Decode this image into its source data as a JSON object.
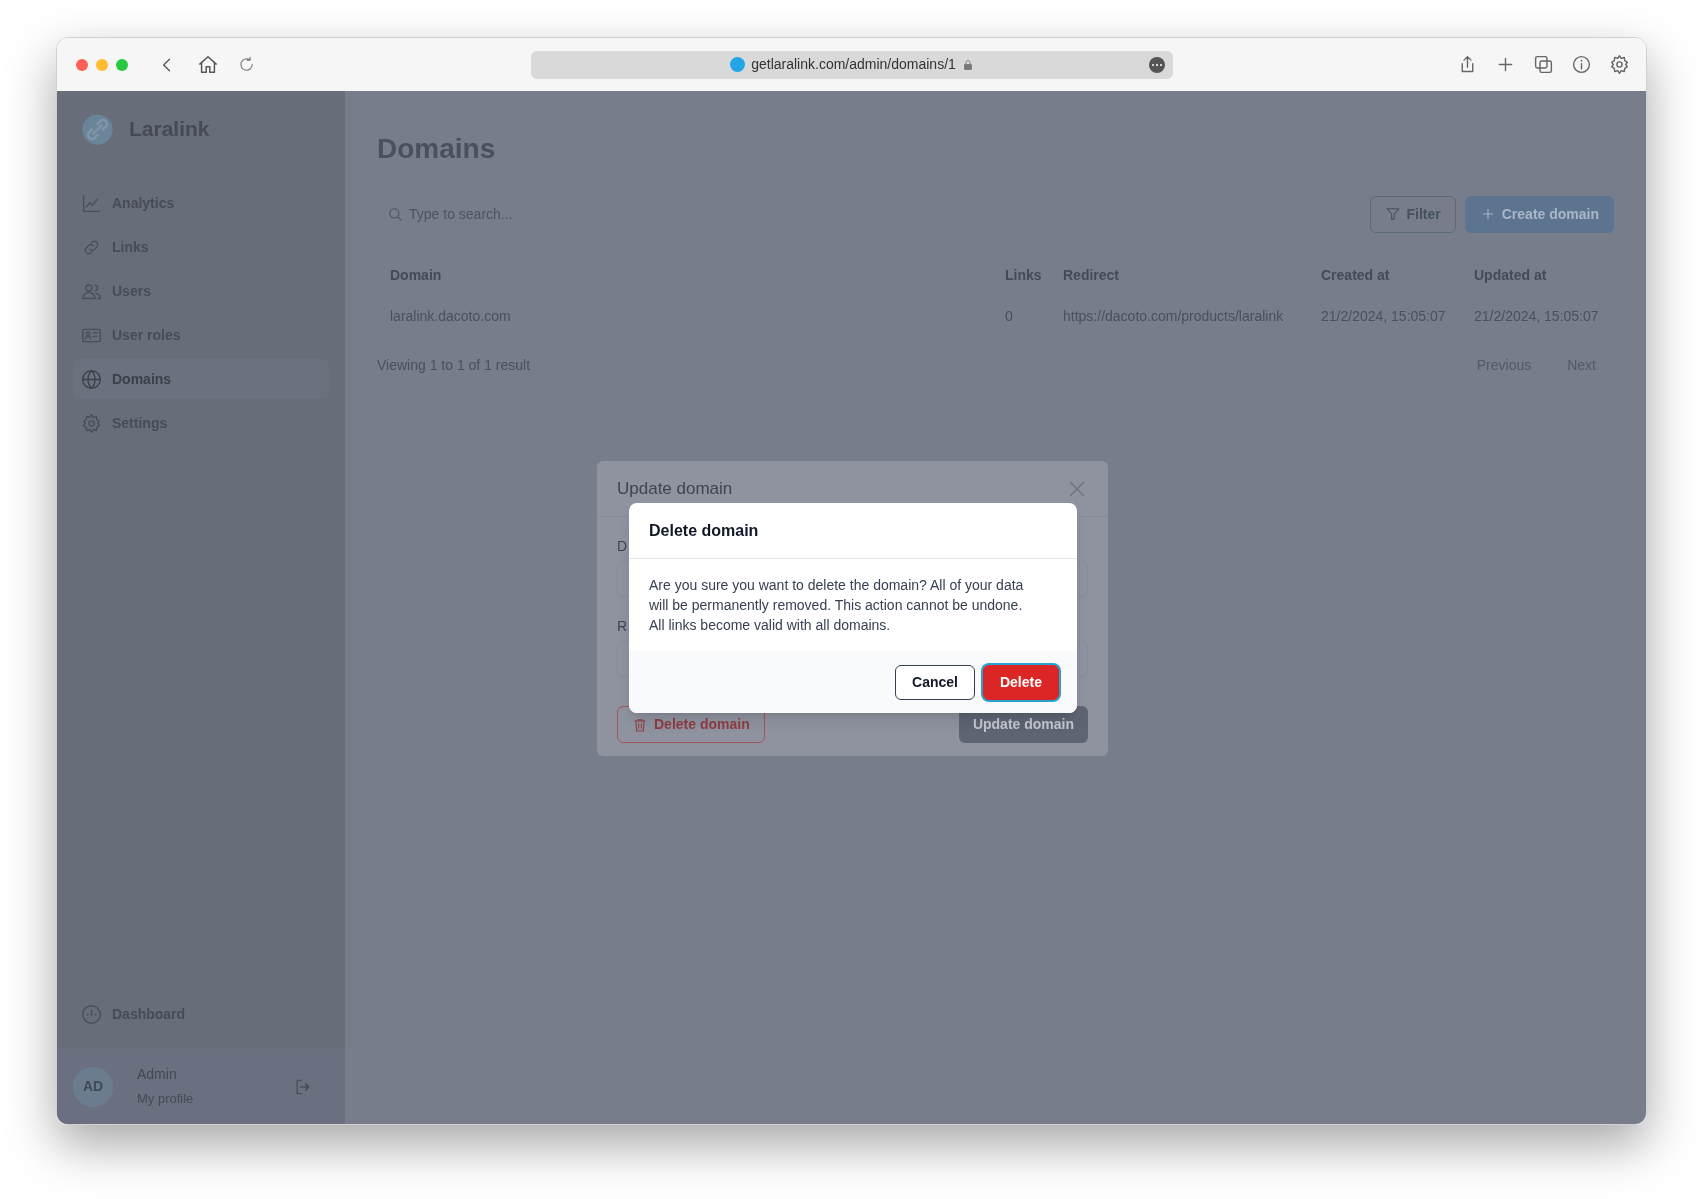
{
  "browser": {
    "url": "getlaralink.com/admin/domains/1"
  },
  "sidebar": {
    "brand": "Laralink",
    "items": [
      {
        "label": "Analytics",
        "selected": false
      },
      {
        "label": "Links",
        "selected": false
      },
      {
        "label": "Users",
        "selected": false
      },
      {
        "label": "User roles",
        "selected": false
      },
      {
        "label": "Domains",
        "selected": true
      },
      {
        "label": "Settings",
        "selected": false
      }
    ],
    "bottom_items": [
      {
        "label": "Dashboard"
      }
    ],
    "user": {
      "initials": "AD",
      "name": "Admin",
      "link": "My profile"
    }
  },
  "page": {
    "title": "Domains",
    "search": {
      "placeholder": "Type to search..."
    },
    "buttons": [
      {
        "label": "Filter",
        "kind": "secondary"
      },
      {
        "label": "Create domain",
        "kind": "primary"
      }
    ],
    "table": {
      "columns": [
        "Domain",
        "Links",
        "Redirect",
        "Created at",
        "Updated at"
      ],
      "rows": [
        [
          "laralink.dacoto.com",
          "0",
          "https://dacoto.com/products/laralink",
          "21/2/2024, 15:05:07",
          "21/2/2024, 15:05:07"
        ]
      ]
    },
    "footer": {
      "summary": "Viewing 1 to 1 of 1 result",
      "previous": "Previous",
      "next": "Next"
    }
  },
  "update_modal": {
    "title": "Update domain",
    "fields": [
      {
        "label": "D"
      },
      {
        "label": "R"
      }
    ],
    "buttons": [
      {
        "label": "Delete domain",
        "kind": "danger-outline"
      },
      {
        "label": "Update domain",
        "kind": "primary"
      }
    ]
  },
  "delete_dialog": {
    "title": "Delete domain",
    "message": "Are you sure you want to delete the domain? All of your data will be permanently removed. This action cannot be undone. All links become valid with all domains.",
    "buttons": [
      {
        "label": "Cancel",
        "kind": "secondary",
        "focused": false
      },
      {
        "label": "Delete",
        "kind": "danger",
        "focused": true
      }
    ]
  }
}
